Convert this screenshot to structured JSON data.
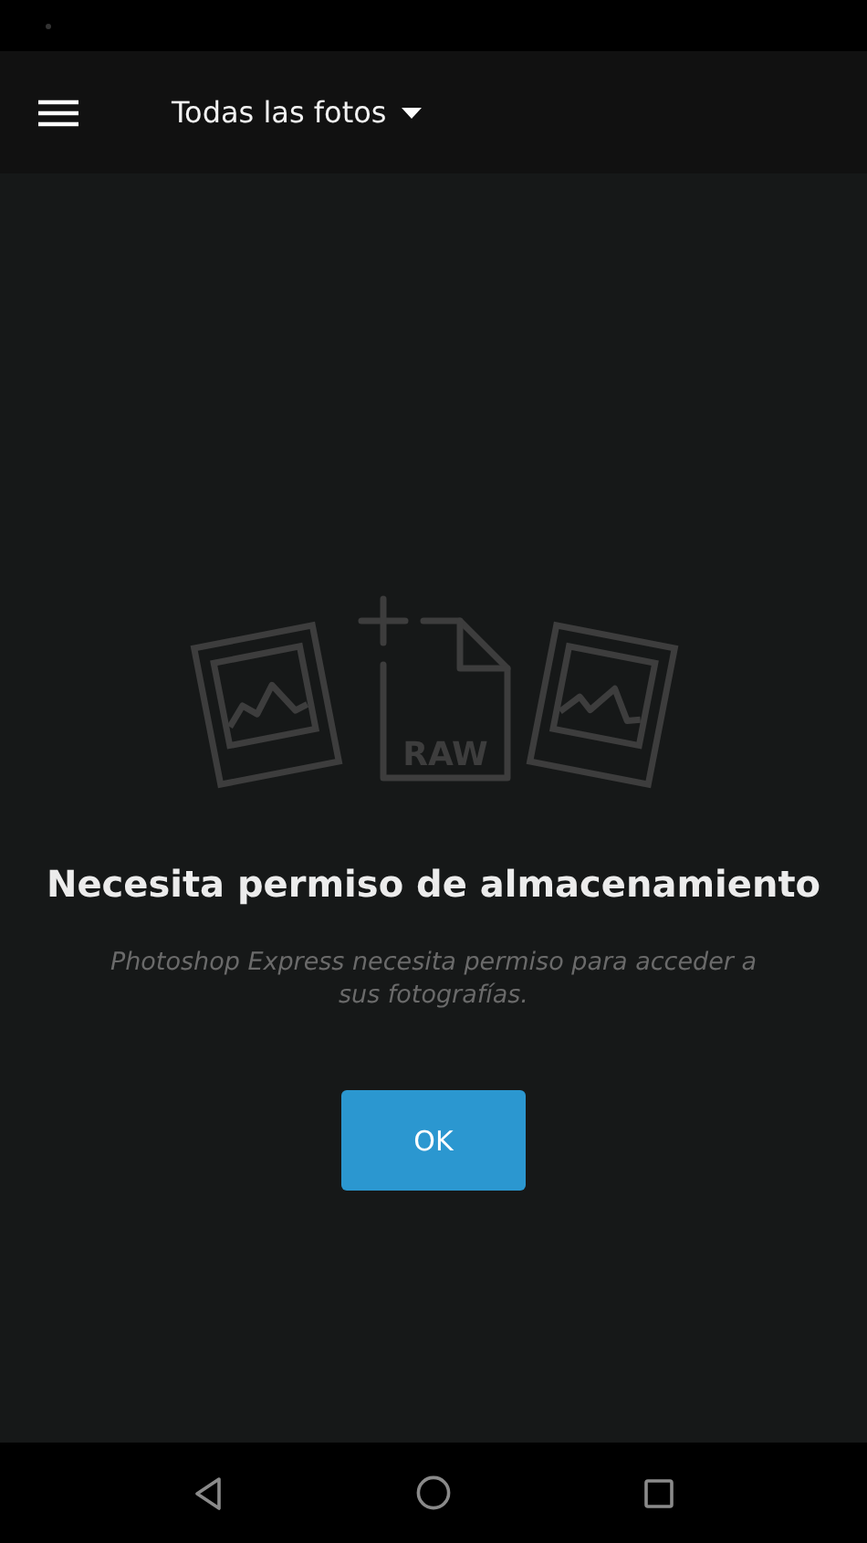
{
  "toolbar": {
    "title": "Todas las fotos"
  },
  "illustration": {
    "file_label": "RAW"
  },
  "message": {
    "title": "Necesita permiso de almacenamiento",
    "body": "Photoshop Express necesita permiso para acceder a sus fotografías."
  },
  "buttons": [
    {
      "label": "OK"
    }
  ],
  "nav_bar": {
    "buttons": [
      {
        "kind": "back"
      },
      {
        "kind": "home"
      },
      {
        "kind": "recents"
      }
    ]
  }
}
